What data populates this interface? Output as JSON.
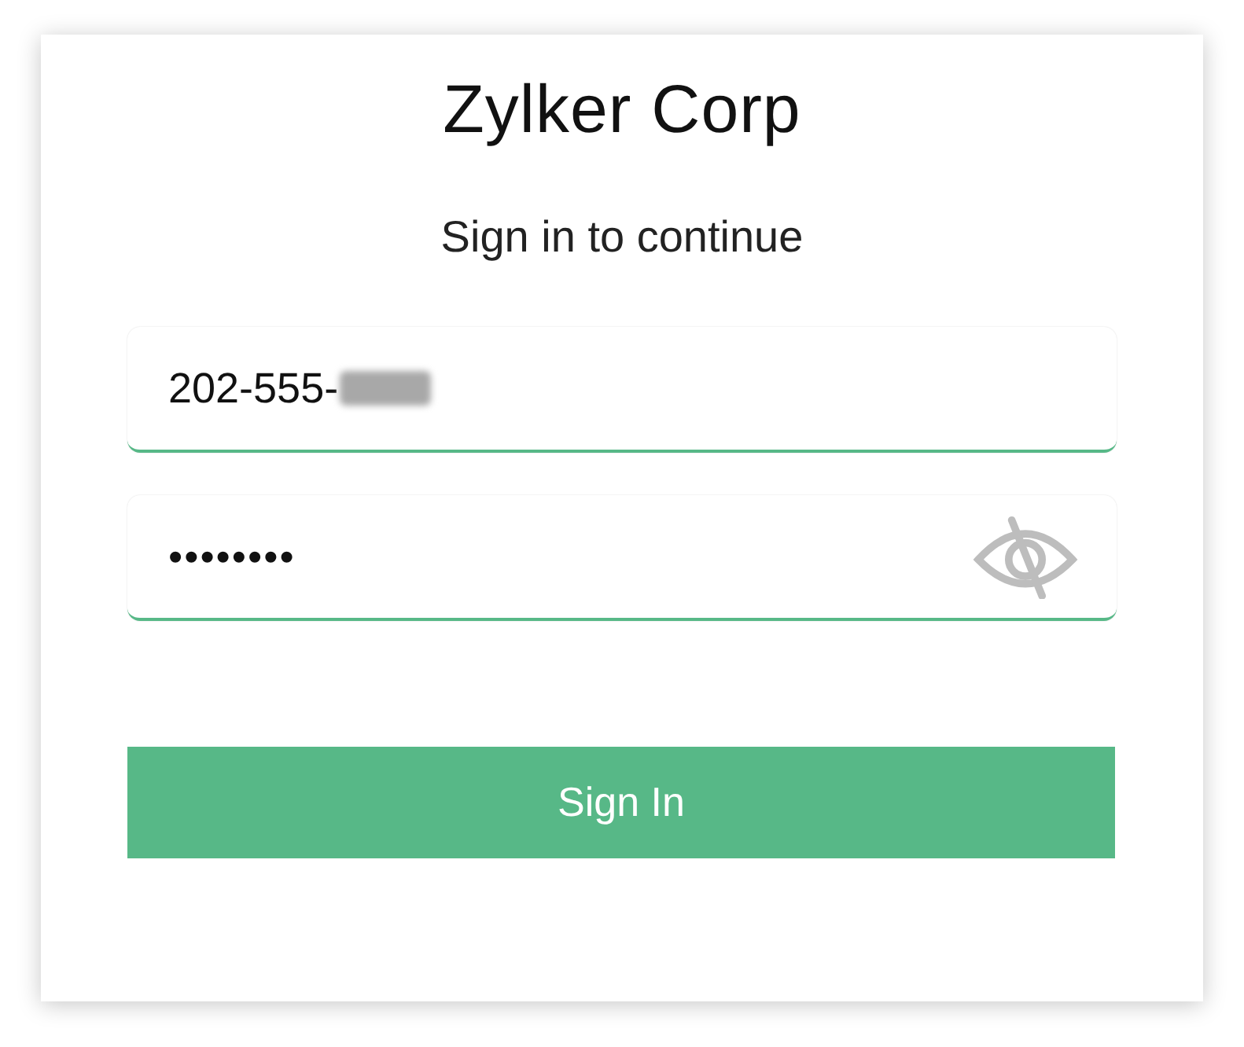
{
  "title": "Zylker Corp",
  "subtitle": "Sign in to continue",
  "fields": [
    {
      "kind": "phone",
      "value": "202-555-",
      "redacted": true
    },
    {
      "kind": "password",
      "value": "••••••••",
      "visibility_toggle": true
    }
  ],
  "button": "Sign In"
}
